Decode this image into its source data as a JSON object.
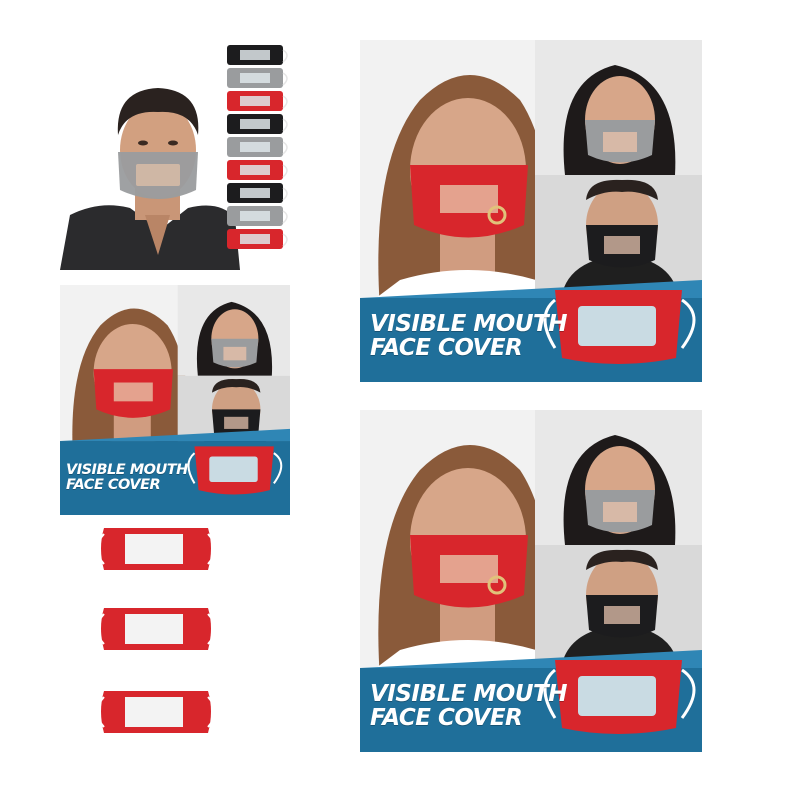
{
  "collage": {
    "banner_line1": "VISIBLE MOUTH",
    "banner_line2": "FACE COVER"
  },
  "colors": {
    "mask_red": "#d8262c",
    "mask_gray": "#9a9c9e",
    "mask_black": "#1c1c1e",
    "banner_blue": "#1f6f9a",
    "window_clear": "#c9dbe3"
  },
  "mask_pack_colors": [
    "black",
    "gray",
    "red",
    "black",
    "gray",
    "red",
    "black",
    "gray",
    "red"
  ]
}
